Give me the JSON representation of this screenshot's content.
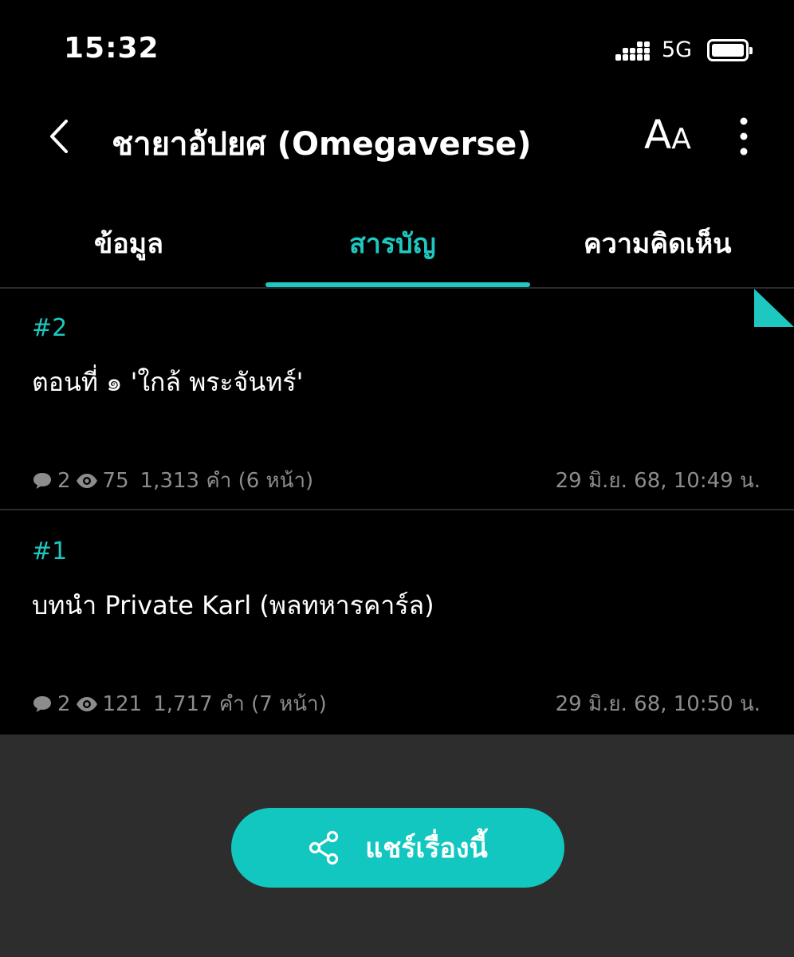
{
  "status_bar": {
    "time": "15:32",
    "network": "5G"
  },
  "nav": {
    "title": "ชายาอัปยศ (Omegaverse)",
    "font_size_label_big": "A",
    "font_size_label_small": "A"
  },
  "tabs": [
    {
      "label": "ข้อมูล",
      "active": false
    },
    {
      "label": "สารบัญ",
      "active": true
    },
    {
      "label": "ความคิดเห็น",
      "active": false
    }
  ],
  "episodes": [
    {
      "number": "#2",
      "title": "ตอนที่ ๑ 'ใกล้ พระจันทร์'",
      "comments": "2",
      "views": "75",
      "words": "1,313 คำ (6 หน้า)",
      "date": "29 มิ.ย. 68, 10:49 น."
    },
    {
      "number": "#1",
      "title": "บทนำ Private Karl (พลทหารคาร์ล)",
      "comments": "2",
      "views": "121",
      "words": "1,717 คำ (7 หน้า)",
      "date": "29 มิ.ย. 68, 10:50 น."
    }
  ],
  "share_button": {
    "label": "แชร์เรื่องนี้"
  },
  "colors": {
    "accent": "#1ec8c0",
    "background": "#000000",
    "footer": "#2d2d2d",
    "muted_text": "#8c8c8c"
  },
  "icons": {
    "back": "chevron-left-icon",
    "font": "font-size-icon",
    "more": "more-vertical-icon",
    "comment": "comment-icon",
    "views": "eye-icon",
    "share": "share-icon"
  }
}
